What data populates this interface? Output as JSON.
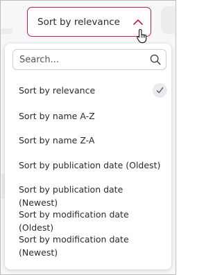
{
  "sort_button": {
    "label": "Sort by relevance"
  },
  "dropdown": {
    "search_placeholder": "Search...",
    "search_value": "",
    "options": [
      {
        "label": "Sort by relevance",
        "selected": true
      },
      {
        "label": "Sort by name A-Z",
        "selected": false
      },
      {
        "label": "Sort by name Z-A",
        "selected": false
      },
      {
        "label": "Sort by publication date (Oldest)",
        "selected": false
      },
      {
        "label": "Sort by publication date (Newest)",
        "selected": false
      },
      {
        "label": "Sort by modification date (Oldest)",
        "selected": false
      },
      {
        "label": "Sort by modification date (Newest)",
        "selected": false
      }
    ]
  },
  "icons": {
    "chevron": "chevron-up-icon",
    "cursor": "hand-pointer-icon",
    "search": "search-icon",
    "check": "check-icon"
  },
  "colors": {
    "accent": "#c2185b",
    "check_bg": "#e9e9ee"
  }
}
